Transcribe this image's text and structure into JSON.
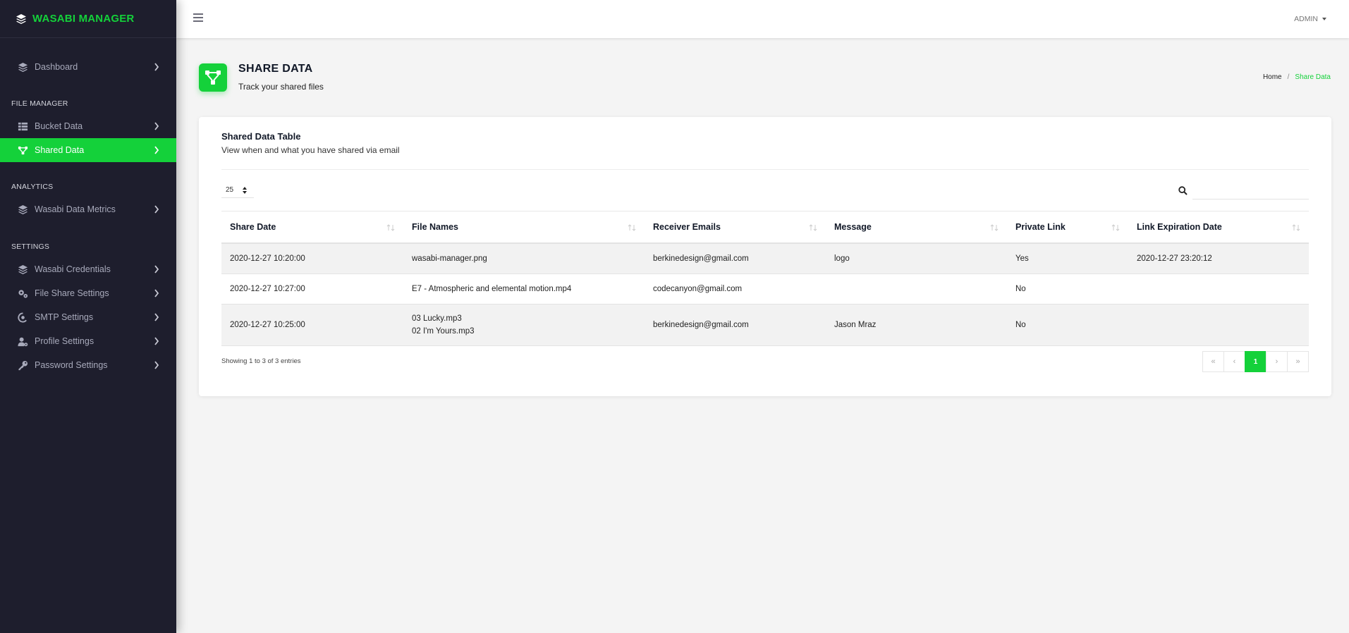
{
  "brand": {
    "name": "WASABI MANAGER",
    "color": "#14d13a"
  },
  "sidebar": {
    "sections": {
      "file_manager": "FILE MANAGER",
      "analytics": "ANALYTICS",
      "settings": "SETTINGS"
    },
    "items": {
      "dashboard": {
        "label": "Dashboard",
        "icon": "layers-icon"
      },
      "bucket_data": {
        "label": "Bucket Data",
        "icon": "table-icon"
      },
      "shared_data": {
        "label": "Shared Data",
        "icon": "share-nodes-icon",
        "active": true
      },
      "wasabi_data_metrics": {
        "label": "Wasabi Data Metrics",
        "icon": "layers-icon"
      },
      "wasabi_credentials": {
        "label": "Wasabi Credentials",
        "icon": "layers-icon"
      },
      "file_share_settings": {
        "label": "File Share Settings",
        "icon": "gears-icon"
      },
      "smtp_settings": {
        "label": "SMTP Settings",
        "icon": "at-icon"
      },
      "profile_settings": {
        "label": "Profile Settings",
        "icon": "user-gear-icon"
      },
      "password_settings": {
        "label": "Password Settings",
        "icon": "key-icon"
      }
    }
  },
  "topbar": {
    "user": "ADMIN"
  },
  "page": {
    "title": "SHARE DATA",
    "subtitle": "Track your shared files",
    "breadcrumb": {
      "home": "Home",
      "separator": "/",
      "current": "Share Data"
    }
  },
  "card": {
    "title": "Shared Data Table",
    "description": "View when and what you have shared via email",
    "length_value": "25",
    "search_value": ""
  },
  "table": {
    "headers": [
      "Share Date",
      "File Names",
      "Receiver Emails",
      "Message",
      "Private Link",
      "Link Expiration Date"
    ],
    "rows": [
      {
        "share_date": "2020-12-27 10:20:00",
        "files": [
          "wasabi-manager.png"
        ],
        "email": "berkinedesign@gmail.com",
        "message": "logo",
        "private": "Yes",
        "expiration": "2020-12-27 23:20:12"
      },
      {
        "share_date": "2020-12-27 10:27:00",
        "files": [
          "E7 - Atmospheric and elemental motion.mp4"
        ],
        "email": "codecanyon@gmail.com",
        "message": "",
        "private": "No",
        "expiration": ""
      },
      {
        "share_date": "2020-12-27 10:25:00",
        "files": [
          "03 Lucky.mp3",
          "02 I'm Yours.mp3"
        ],
        "email": "berkinedesign@gmail.com",
        "message": "Jason Mraz",
        "private": "No",
        "expiration": ""
      }
    ]
  },
  "footer": {
    "info": "Showing 1 to 3 of 3 entries",
    "pagination": {
      "first": "«",
      "prev": "‹",
      "current": "1",
      "next": "›",
      "last": "»"
    }
  }
}
